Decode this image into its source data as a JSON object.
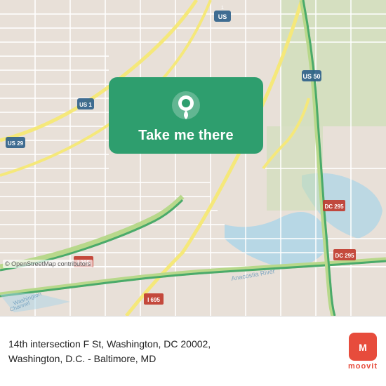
{
  "map": {
    "attribution": "© OpenStreetMap contributors"
  },
  "card": {
    "button_label": "Take me there",
    "pin_icon": "location-pin"
  },
  "info": {
    "address_line1": "14th intersection F St, Washington, DC 20002,",
    "address_line2": "Washington, D.C. - Baltimore, MD"
  },
  "branding": {
    "logo_icon": "moovit-logo",
    "logo_label": "moovit"
  },
  "colors": {
    "card_green": "#2e9e6e",
    "moovit_red": "#e74c3c",
    "road_yellow": "#f0d060",
    "highway_green": "#4aaa6a"
  }
}
